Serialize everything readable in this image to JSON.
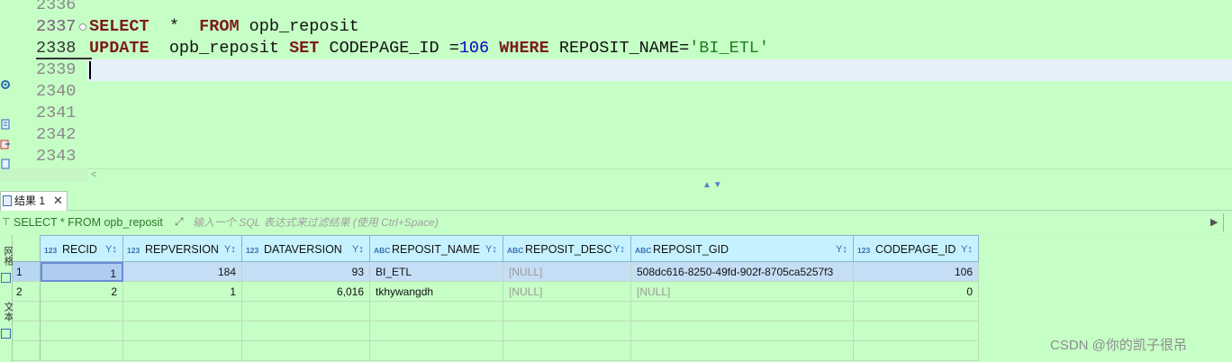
{
  "editor": {
    "line_numbers": [
      "2336",
      "2337",
      "2338",
      "2339",
      "2340",
      "2341",
      "2342",
      "2343"
    ],
    "lines": {
      "l2337": {
        "kw1": "SELECT",
        "mid": "  *  ",
        "kw2": "FROM",
        "rest": " opb_reposit"
      },
      "l2338": {
        "kw1": "UPDATE",
        "t1": "  opb_reposit ",
        "kw2": "SET",
        "t2": " CODEPAGE_ID =",
        "num": "106",
        "t3": " ",
        "kw3": "WHERE",
        "t4": " REPOSIT_NAME=",
        "str": "'BI_ETL'"
      }
    }
  },
  "result_tab": {
    "label": "结果 1",
    "close": "✕"
  },
  "filter": {
    "query": "SELECT * FROM opb_reposit",
    "placeholder": "输入一个 SQL 表达式来过滤结果 (使用 Ctrl+Space)"
  },
  "side_tabs": {
    "grid": "网格",
    "text": "文本"
  },
  "grid": {
    "columns": [
      {
        "type": "123",
        "name": "RECID"
      },
      {
        "type": "123",
        "name": "REPVERSION"
      },
      {
        "type": "123",
        "name": "DATAVERSION"
      },
      {
        "type": "ABC",
        "name": "REPOSIT_NAME"
      },
      {
        "type": "ABC",
        "name": "REPOSIT_DESC"
      },
      {
        "type": "ABC",
        "name": "REPOSIT_GID"
      },
      {
        "type": "123",
        "name": "CODEPAGE_ID"
      }
    ],
    "rows": [
      {
        "num": "1",
        "cells": [
          "1",
          "184",
          "93",
          "BI_ETL",
          "[NULL]",
          "508dc616-8250-49fd-902f-8705ca5257f3",
          "106"
        ]
      },
      {
        "num": "2",
        "cells": [
          "2",
          "1",
          "6,016",
          "tkhywangdh",
          "[NULL]",
          "[NULL]",
          "0"
        ]
      }
    ]
  },
  "watermark": "CSDN @你的凯子很吊",
  "colors": {
    "editor_bg": "#c6ffc6",
    "keyword": "#7b1c1c",
    "number": "#0000c8",
    "string": "#1a7f1a",
    "header_bg": "#c6f2ff",
    "selected_row": "#c6def5"
  }
}
